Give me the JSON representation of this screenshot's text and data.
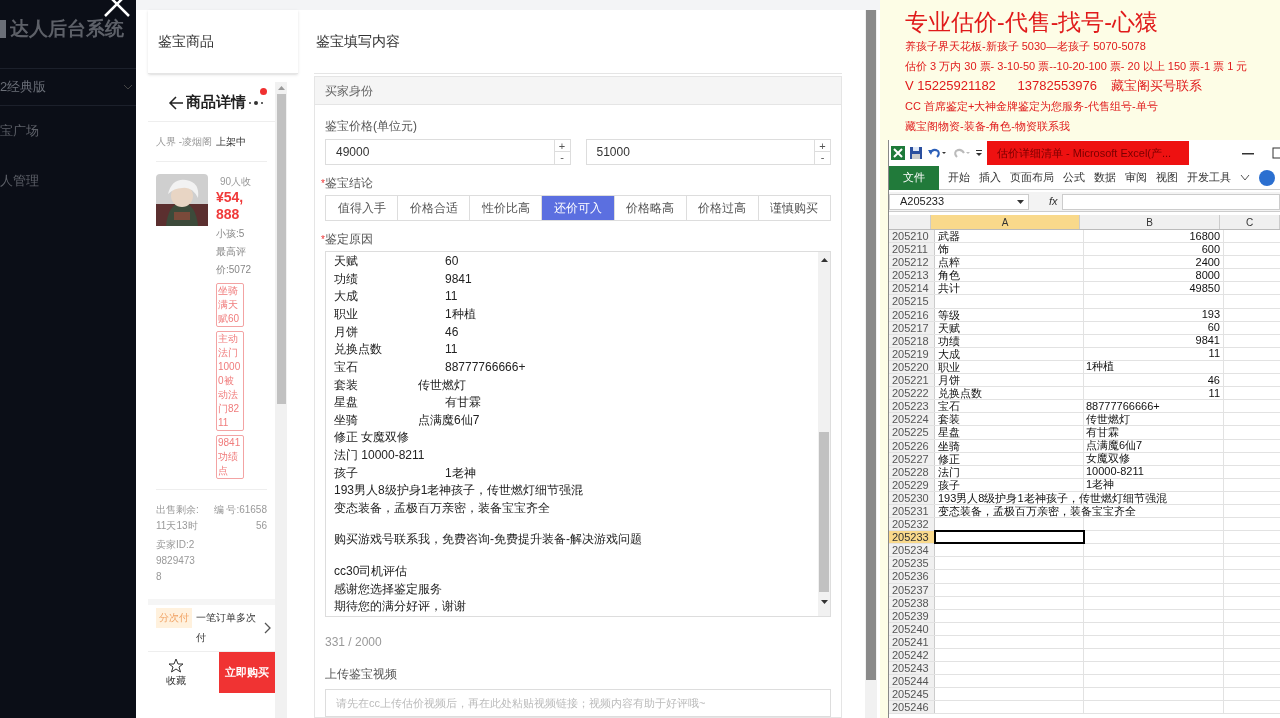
{
  "sidebar": {
    "title": "达人后台系统",
    "version": "2经典版",
    "items": [
      {
        "label": "宝广场"
      },
      {
        "label": "人管理"
      }
    ]
  },
  "preview": {
    "heading": "鉴宝商品",
    "nav_title": "商品详情",
    "breadcrumb": "人界 -凌烟阁",
    "status": "上架中",
    "favorites": "90人收",
    "price": "¥54,888",
    "info": "小孩:5最高评价:5072",
    "tags": [
      "坐骑满天赋60",
      "主动法门10000被动法门8211",
      "9841功绩点"
    ],
    "remaining": "出售剩余: 11天13时",
    "serial": "编 号:6165856",
    "seller": "卖家ID:298294738",
    "pay_badge": "分次付",
    "pay_text": "一笔订单多次付",
    "favorite_label": "收藏",
    "buy_button": "立即购买"
  },
  "form": {
    "heading": "鉴宝填写内容",
    "section": "买家身份",
    "price_label": "鉴宝价格(单位元)",
    "prices": [
      {
        "value": "49000",
        "up": "+",
        "down": "-"
      },
      {
        "value": "51000",
        "up": "+",
        "down": "-"
      }
    ],
    "conclusion": {
      "mark": "*",
      "label": "鉴宝结论"
    },
    "options": [
      {
        "label": "值得入手",
        "selected": false
      },
      {
        "label": "价格合适",
        "selected": false
      },
      {
        "label": "性价比高",
        "selected": false
      },
      {
        "label": "还价可入",
        "selected": true
      },
      {
        "label": "价格略高",
        "selected": false
      },
      {
        "label": "价格过高",
        "selected": false
      },
      {
        "label": "谨慎购买",
        "selected": false
      }
    ],
    "reason": {
      "mark": "*",
      "label": "鉴定原因"
    },
    "reason_lines": [
      {
        "kind": "pair",
        "key": "天赋",
        "value": "60"
      },
      {
        "kind": "pair",
        "key": "功绩",
        "value": "9841"
      },
      {
        "kind": "pair",
        "key": "大成",
        "value": "11"
      },
      {
        "kind": "pair",
        "key": "职业",
        "value": "1种植"
      },
      {
        "kind": "pair",
        "key": "月饼",
        "value": "46"
      },
      {
        "kind": "pair",
        "key": "兑换点数",
        "value": "11"
      },
      {
        "kind": "pair",
        "key": "宝石",
        "value": "88777766666+"
      },
      {
        "kind": "pair_short",
        "key": "套装",
        "value": "传世燃灯"
      },
      {
        "kind": "pair",
        "key": "星盘",
        "value": "有甘霖"
      },
      {
        "kind": "pair_short",
        "key": "坐骑",
        "value": "点满魔6仙7"
      },
      {
        "kind": "text",
        "text": "修正 女魔双修"
      },
      {
        "kind": "text",
        "text": "法门 10000-8211"
      },
      {
        "kind": "pair",
        "key": "孩子",
        "value": "1老神"
      },
      {
        "kind": "text",
        "text": "193男人8级护身1老神孩子，传世燃灯细节强混"
      },
      {
        "kind": "text",
        "text": "变态装备，孟极百万亲密，装备宝宝齐全"
      },
      {
        "kind": "blank"
      },
      {
        "kind": "text",
        "text": "购买游戏号联系我，免费咨询-免费提升装备-解决游戏问题"
      },
      {
        "kind": "blank"
      },
      {
        "kind": "text",
        "text": "cc30司机评估"
      },
      {
        "kind": "text",
        "text": "感谢您选择鉴定服务"
      },
      {
        "kind": "text",
        "text": "期待您的满分好评，谢谢"
      }
    ],
    "counter": "331 / 2000",
    "video_label": "上传鉴宝视频",
    "video_placeholder": "请先在cc上传估价视频后，再在此处粘贴视频链接；视频内容有助于好评哦~"
  },
  "notice": {
    "title": "专业估价-代售-找号-心猿",
    "lines": [
      {
        "kind": "small",
        "text": "养孩子界天花板-新孩子 5030—老孩子 5070-5078"
      },
      {
        "kind": "small",
        "text": "估价 3 万内 30 票- 3-10-50 票--10-20-100 票- 20 以上 150 票-1 票 1 元"
      },
      {
        "kind": "large",
        "text": "V 15225921182      13782553976    藏宝阁买号联系"
      },
      {
        "kind": "small",
        "text": "CC 首席鉴定+大神金牌鉴定为您服务-代售组号-单号"
      },
      {
        "kind": "small",
        "text": "藏宝阁物资-装备-角色-物资联系我"
      }
    ]
  },
  "excel": {
    "title": "估价详细清单 - Microsoft Excel(产...",
    "tabs": [
      {
        "label": "文件",
        "kind": "file"
      },
      {
        "label": "开始",
        "kind": "tab"
      },
      {
        "label": "插入",
        "kind": "tab"
      },
      {
        "label": "页面布局",
        "kind": "tab"
      },
      {
        "label": "公式",
        "kind": "tab"
      },
      {
        "label": "数据",
        "kind": "tab"
      },
      {
        "label": "审阅",
        "kind": "tab"
      },
      {
        "label": "视图",
        "kind": "tab"
      },
      {
        "label": "开发工具",
        "kind": "tab"
      }
    ],
    "name_box": "A205233",
    "formula_icon": "fx",
    "columns": [
      {
        "label": "A",
        "selected": true
      },
      {
        "label": "B",
        "selected": false
      },
      {
        "label": "C",
        "selected": false
      }
    ],
    "rows": [
      {
        "num": "205210",
        "a": "武器",
        "b": "16800",
        "kind": "number",
        "selected": false
      },
      {
        "num": "205211",
        "a": "饰",
        "b": "600",
        "kind": "number",
        "selected": false
      },
      {
        "num": "205212",
        "a": "点粹",
        "b": "2400",
        "kind": "number",
        "selected": false
      },
      {
        "num": "205213",
        "a": "角色",
        "b": "8000",
        "kind": "number",
        "selected": false
      },
      {
        "num": "205214",
        "a": "共计",
        "b": "49850",
        "kind": "number",
        "selected": false
      },
      {
        "num": "205215",
        "selected": false
      },
      {
        "num": "205216",
        "a": "等级",
        "b": "193",
        "kind": "number",
        "selected": false
      },
      {
        "num": "205217",
        "a": "天赋",
        "b": "60",
        "kind": "number",
        "selected": false
      },
      {
        "num": "205218",
        "a": "功绩",
        "b": "9841",
        "kind": "number",
        "selected": false
      },
      {
        "num": "205219",
        "a": "大成",
        "b": "11",
        "kind": "number",
        "selected": false
      },
      {
        "num": "205220",
        "a": "职业",
        "b": "1种植",
        "kind": "text",
        "selected": false
      },
      {
        "num": "205221",
        "a": "月饼",
        "b": "46",
        "kind": "number",
        "selected": false
      },
      {
        "num": "205222",
        "a": "兑换点数",
        "b": "11",
        "kind": "number",
        "selected": false
      },
      {
        "num": "205223",
        "a": "宝石",
        "b": "88777766666+",
        "kind": "text",
        "selected": false
      },
      {
        "num": "205224",
        "a": "套装",
        "b": "传世燃灯",
        "kind": "text",
        "selected": false
      },
      {
        "num": "205225",
        "a": "星盘",
        "b": "有甘霖",
        "kind": "text",
        "selected": false
      },
      {
        "num": "205226",
        "a": "坐骑",
        "b": "点满魔6仙7",
        "kind": "text",
        "selected": false
      },
      {
        "num": "205227",
        "a": "修正",
        "b": "女魔双修",
        "kind": "text",
        "selected": false
      },
      {
        "num": "205228",
        "a": "法门",
        "b": "10000-8211",
        "kind": "text",
        "selected": false
      },
      {
        "num": "205229",
        "a": "孩子",
        "b": "1老神",
        "kind": "text",
        "selected": false
      },
      {
        "num": "205230",
        "a": "193男人8级护身1老神孩子，传世燃灯细节强混",
        "kind": "span",
        "selected": false
      },
      {
        "num": "205231",
        "a": "变态装备，孟极百万亲密，装备宝宝齐全",
        "kind": "span",
        "selected": false
      },
      {
        "num": "205232",
        "selected": false
      },
      {
        "num": "205233",
        "selected": true
      },
      {
        "num": "205234",
        "selected": false
      },
      {
        "num": "205235",
        "selected": false
      },
      {
        "num": "205236",
        "selected": false
      },
      {
        "num": "205237",
        "selected": false
      },
      {
        "num": "205238",
        "selected": false
      },
      {
        "num": "205239",
        "selected": false
      },
      {
        "num": "205240",
        "selected": false
      },
      {
        "num": "205241",
        "selected": false
      },
      {
        "num": "205242",
        "selected": false
      },
      {
        "num": "205243",
        "selected": false
      },
      {
        "num": "205244",
        "selected": false
      },
      {
        "num": "205245",
        "selected": false
      },
      {
        "num": "205246",
        "selected": false
      }
    ]
  }
}
